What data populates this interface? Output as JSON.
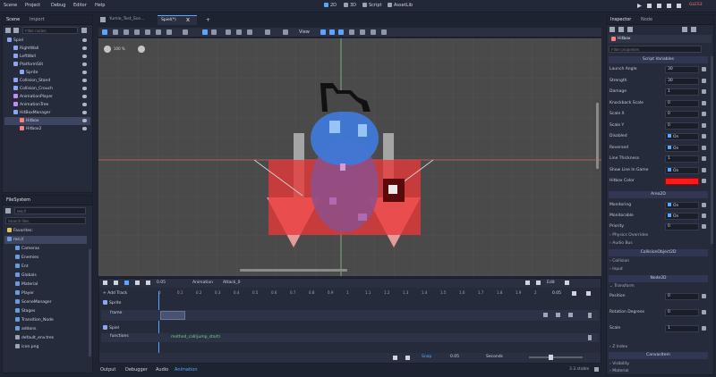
{
  "menu": [
    "Scene",
    "Project",
    "Debug",
    "Editor",
    "Help"
  ],
  "workspaces": [
    "2D",
    "3D",
    "Script",
    "AssetLib"
  ],
  "run_label": "GLES3",
  "scene_panel": {
    "tabs": [
      "Scene",
      "Import"
    ],
    "filter_placeholder": "Filter nodes",
    "nodes": [
      {
        "label": "Spiel",
        "depth": 0,
        "color": "#8da5f3"
      },
      {
        "label": "RightWall",
        "depth": 1,
        "color": "#8da5f3"
      },
      {
        "label": "LeftWall",
        "depth": 1,
        "color": "#8da5f3"
      },
      {
        "label": "PlatformSlit",
        "depth": 1,
        "color": "#8da5f3"
      },
      {
        "label": "Sprite",
        "depth": 2,
        "color": "#8da5f3"
      },
      {
        "label": "Collision_Stand",
        "depth": 1,
        "color": "#8da5f3"
      },
      {
        "label": "Collision_Crouch",
        "depth": 1,
        "color": "#8da5f3"
      },
      {
        "label": "AnimationPlayer",
        "depth": 1,
        "color": "#c38ef1"
      },
      {
        "label": "AnimationTree",
        "depth": 1,
        "color": "#c38ef1"
      },
      {
        "label": "HitBoxManager",
        "depth": 1,
        "color": "#8da5f3"
      },
      {
        "label": "Hitbox",
        "depth": 2,
        "color": "#fc7f7f"
      },
      {
        "label": "Hitbox2",
        "depth": 2,
        "color": "#fc7f7f"
      }
    ]
  },
  "filesystem": {
    "tab": "FileSystem",
    "path": "res://",
    "search_placeholder": "Search files",
    "items": [
      "Favorites:",
      "res://",
      "Cameras",
      "Enemies",
      "Ent",
      "Globals",
      "Material",
      "Player",
      "SceneManager",
      "Stages",
      "Transition_Node",
      "addons",
      "default_env.tres",
      "icon.png"
    ]
  },
  "tabs": [
    "Yumle_Test_Sce...",
    "Spiel(*)"
  ],
  "viewport": {
    "view_menu": "View",
    "zoom_label": "100 %"
  },
  "animation": {
    "add_track": "+ Add Track",
    "label": "Animation",
    "anim_name": "Attack_0",
    "length": "0.05",
    "edit": "Edit",
    "ticks": [
      "0",
      "0.1",
      "0.2",
      "0.3",
      "0.4",
      "0.5",
      "0.6",
      "0.7",
      "0.8",
      "0.9",
      "1",
      "1.1",
      "1.2",
      "1.3",
      "1.4",
      "1.5",
      "1.6",
      "1.7",
      "1.8",
      "1.9",
      "2"
    ],
    "tracks": [
      {
        "node": "Sprite",
        "prop": "frame"
      },
      {
        "node": "Spiel",
        "prop": "functions"
      }
    ],
    "method_key": "method_call(jump_start)",
    "snap": "Snap",
    "step": "0.05",
    "unit": "Seconds"
  },
  "bottom_tabs": [
    "Output",
    "Debugger",
    "Audio",
    "Animation"
  ],
  "version": "3.3.stable",
  "inspector": {
    "tabs": [
      "Inspector",
      "Node"
    ],
    "node_name": "Hitbox",
    "filter_placeholder": "Filter properties",
    "script_vars": "Script Variables",
    "props": [
      {
        "k": "Launch Angle",
        "v": "30"
      },
      {
        "k": "Strength",
        "v": "30"
      },
      {
        "k": "Damage",
        "v": "1"
      },
      {
        "k": "Knockback Scale",
        "v": "0"
      },
      {
        "k": "Scale X",
        "v": "0"
      },
      {
        "k": "Scale Y",
        "v": "0"
      },
      {
        "k": "Disabled",
        "v": "On"
      },
      {
        "k": "Reversed",
        "v": "On"
      },
      {
        "k": "Line Thickness",
        "v": "1"
      },
      {
        "k": "Show Line In Game",
        "v": "On"
      },
      {
        "k": "Hitbox Color",
        "v": ""
      }
    ],
    "area_section": "Area2D",
    "props2": [
      {
        "k": "Monitoring",
        "v": "On"
      },
      {
        "k": "Monitorable",
        "v": "On"
      },
      {
        "k": "Priority",
        "v": "0"
      }
    ],
    "groups": [
      "Physics Overrides",
      "Audio Bus"
    ],
    "collision_obj": "CollisionObject2D",
    "groups2": [
      "Collision",
      "Input"
    ],
    "node2d": "Node2D",
    "transform": "Transform",
    "tprops": [
      {
        "k": "Position",
        "v": "0"
      },
      {
        "k": "Rotation Degrees",
        "v": "0"
      },
      {
        "k": "Scale",
        "v": "1"
      }
    ],
    "zindex": "Z Index",
    "canvas": "CanvasItem",
    "groups3": [
      "Visibility",
      "Material"
    ]
  },
  "colors": {
    "hitbox": "#ff1a1a",
    "accent": "#5aa6ff"
  }
}
